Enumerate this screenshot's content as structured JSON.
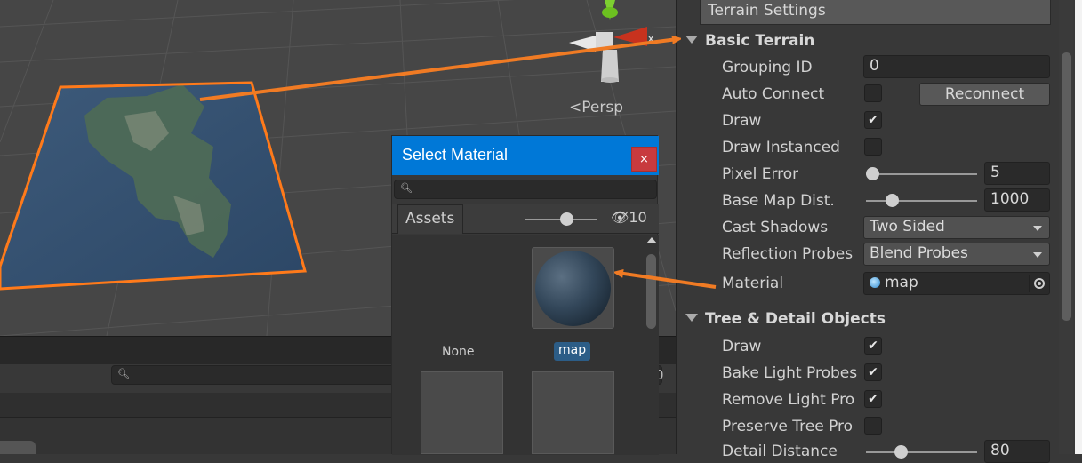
{
  "scene": {
    "persp_label": "Persp",
    "x_axis_label": "x"
  },
  "select_material": {
    "title": "Select Material",
    "close_label": "×",
    "search_placeholder": "",
    "tab_assets": "Assets",
    "hidden_count": "10",
    "items": [
      {
        "label": "None"
      },
      {
        "label": "map"
      }
    ]
  },
  "lower_panel": {
    "search_placeholder": "",
    "count_text": "0"
  },
  "inspector": {
    "terrain_settings": "Terrain Settings",
    "basic_terrain": {
      "title": "Basic Terrain",
      "grouping_id_label": "Grouping ID",
      "grouping_id_value": "0",
      "auto_connect_label": "Auto Connect",
      "auto_connect_checked": false,
      "reconnect_label": "Reconnect",
      "draw_label": "Draw",
      "draw_checked": true,
      "draw_instanced_label": "Draw Instanced",
      "draw_instanced_checked": false,
      "pixel_error_label": "Pixel Error",
      "pixel_error_value": "5",
      "pixel_error_fraction": 0.05,
      "base_map_label": "Base Map Dist.",
      "base_map_value": "1000",
      "base_map_fraction": 0.25,
      "cast_shadows_label": "Cast Shadows",
      "cast_shadows_value": "Two Sided",
      "reflection_label": "Reflection Probes",
      "reflection_value": "Blend Probes",
      "material_label": "Material",
      "material_value": "map"
    },
    "tree_detail": {
      "title": "Tree & Detail Objects",
      "draw_label": "Draw",
      "draw_checked": true,
      "bake_label": "Bake Light Probes",
      "bake_checked": true,
      "remove_label": "Remove Light Pro",
      "remove_checked": true,
      "preserve_label": "Preserve Tree Pro",
      "preserve_checked": false,
      "detail_distance_label": "Detail Distance",
      "detail_distance_value": "80",
      "detail_distance_fraction": 0.4
    }
  },
  "colors": {
    "annotation": "#f07b24",
    "selection": "#ff7a1a",
    "title_bar": "#0078d7",
    "close_button": "#c83a3e"
  }
}
